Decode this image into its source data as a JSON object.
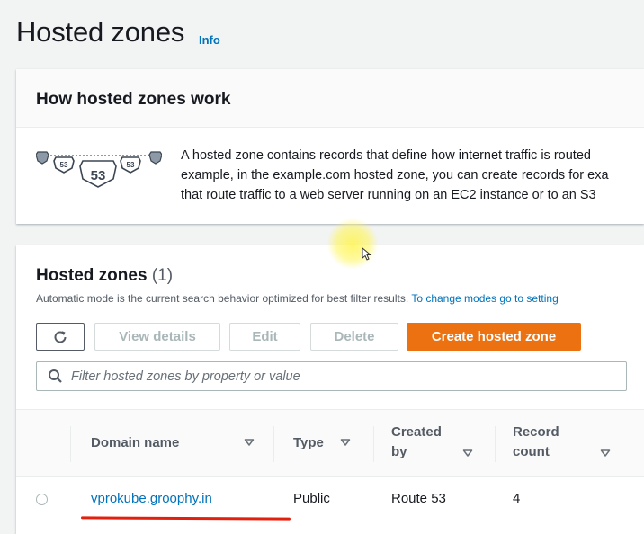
{
  "header": {
    "title": "Hosted zones",
    "info_link": "Info"
  },
  "how_it_works": {
    "title": "How hosted zones work",
    "illustration_icon": "route53-shield-icon",
    "shield_labels": [
      "53",
      "53",
      "53"
    ],
    "text_lines": [
      "A hosted zone contains records that define how internet traffic is routed",
      "example, in the example.com hosted zone, you can create records for exa",
      "that route traffic to a web server running on an EC2 instance or to an S3"
    ]
  },
  "zones": {
    "title": "Hosted zones",
    "count": "(1)",
    "description": "Automatic mode is the current search behavior optimized for best filter results.",
    "description_link": "To change modes go to setting",
    "buttons": {
      "refresh_icon": "refresh-icon",
      "view_details": "View details",
      "edit": "Edit",
      "delete": "Delete",
      "create": "Create hosted zone"
    },
    "search": {
      "placeholder": "Filter hosted zones by property or value"
    },
    "columns": {
      "domain_name": "Domain name",
      "type": "Type",
      "created_by_line1": "Created",
      "created_by_line2": "by",
      "record_count_line1": "Record",
      "record_count_line2": "count"
    },
    "rows": [
      {
        "domain_name": "vprokube.groophy.in",
        "type": "Public",
        "created_by": "Route 53",
        "record_count": "4"
      }
    ]
  },
  "colors": {
    "accent_link": "#0073bb",
    "primary_button": "#ec7211",
    "annotation_underline": "#e3200d",
    "cursor_highlight": "#fff550"
  }
}
